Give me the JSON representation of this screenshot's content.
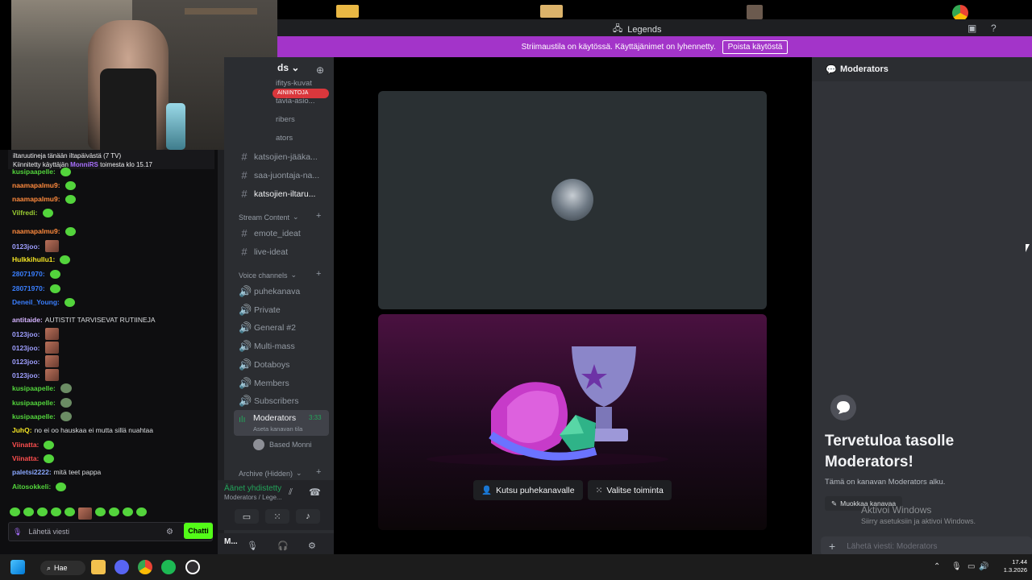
{
  "window": {
    "title": "Legends"
  },
  "banner": {
    "text": "Striimaustila on käytössä. Käyttäjänimet on lyhennetty.",
    "button": "Poista käytöstä"
  },
  "twitch_chat": {
    "pinned_line": "iltaruutineja tänään iltapäivästä (7 TV)",
    "pinned_by_prefix": "Kiinnitetty käyttäjän",
    "pinned_user": "MonniRS",
    "pinned_suffix": "toimesta klo 15.17",
    "messages": [
      {
        "user": "kusipaapelle:",
        "text": "",
        "color": "#53d43c"
      },
      {
        "user": "naamapalmu9:",
        "text": "",
        "color": "#ff8a3d"
      },
      {
        "user": "naamapalmu9:",
        "text": "",
        "color": "#ff8a3d"
      },
      {
        "user": "Vilfredi:",
        "text": "",
        "color": "#9acd32"
      },
      {
        "user": "naamapalmu9:",
        "text": "",
        "color": "#ff8a3d"
      },
      {
        "user": "0123joo:",
        "text": "",
        "color": "#9f9fff"
      },
      {
        "user": "Hulkkihullu1:",
        "text": "",
        "color": "#f5e625"
      },
      {
        "user": "28071970:",
        "text": "",
        "color": "#3a7fff"
      },
      {
        "user": "28071970:",
        "text": "",
        "color": "#3a7fff"
      },
      {
        "user": "Deneil_Young:",
        "text": "",
        "color": "#3a7fff"
      },
      {
        "user": "antitaide:",
        "text": "AUTISTIT TARVISEVAT RUTIINEJA",
        "color": "#d4b3ff"
      },
      {
        "user": "0123joo:",
        "text": "",
        "color": "#9f9fff"
      },
      {
        "user": "0123joo:",
        "text": "",
        "color": "#9f9fff"
      },
      {
        "user": "0123joo:",
        "text": "",
        "color": "#9f9fff"
      },
      {
        "user": "0123joo:",
        "text": "",
        "color": "#9f9fff"
      },
      {
        "user": "kusipaapelle:",
        "text": "",
        "color": "#53d43c"
      },
      {
        "user": "kusipaapelle:",
        "text": "",
        "color": "#53d43c"
      },
      {
        "user": "kusipaapelle:",
        "text": "",
        "color": "#53d43c"
      },
      {
        "user": "JuhQ:",
        "text": "no ei oo hauskaa ei mutta sillä nuahtaa",
        "color": "#f5e625"
      },
      {
        "user": "Viinatta:",
        "text": "",
        "color": "#ff4f4f"
      },
      {
        "user": "Viinatta:",
        "text": "",
        "color": "#ff4f4f"
      },
      {
        "user": "paletsi2222:",
        "text": "mitä teet pappa",
        "color": "#8aa8ff"
      },
      {
        "user": "Aitosokkeli:",
        "text": "",
        "color": "#53d43c"
      }
    ],
    "input_placeholder": "Lähetä viesti",
    "send_button": "Chatti"
  },
  "discord": {
    "server_name_partial": "ds",
    "live_label": "AINIINTOJA",
    "channels_top": [
      {
        "name": "ifitys-kuvat"
      },
      {
        "name": "tavia-asio..."
      },
      {
        "name": "ribers"
      },
      {
        "name": "ators"
      },
      {
        "name": "katsojien-jääka..."
      },
      {
        "name": "saa-juontaja-na..."
      },
      {
        "name": "katsojien-iltaru..."
      }
    ],
    "category_stream": "Stream Content",
    "stream_channels": [
      "emote_ideat",
      "live-ideat"
    ],
    "category_voice": "Voice channels",
    "voice_channels": [
      "puhekanava",
      "Private",
      "General #2",
      "Multi-mass",
      "Dotaboys",
      "Members",
      "Subscribers"
    ],
    "active_voice": {
      "name": "Moderators",
      "time": "3:33",
      "status": "Aseta kanavan tila"
    },
    "voice_member": "Based Monni",
    "category_archive": "Archive (Hidden)",
    "voice_connected": "Äänet yhdistetty",
    "voice_location": "Moderators / Lege...",
    "user_short": "M...",
    "stage_buttons": {
      "invite": "Kutsu puhekanavalle",
      "activity": "Valitse toiminta"
    },
    "text_chat": {
      "title": "Moderators",
      "welcome_title": "Tervetuloa tasolle Moderators!",
      "welcome_sub": "Tämä on kanavan Moderators alku.",
      "edit_button": "Muokkaa kanavaa",
      "input_placeholder": "Lähetä viesti: Moderators"
    }
  },
  "os": {
    "activate_title": "Aktivoi Windows",
    "activate_sub": "Siirry asetuksiin ja aktivoi Windows.",
    "search_label": "Hae",
    "time": "17.44",
    "date": "1.3.2026"
  }
}
